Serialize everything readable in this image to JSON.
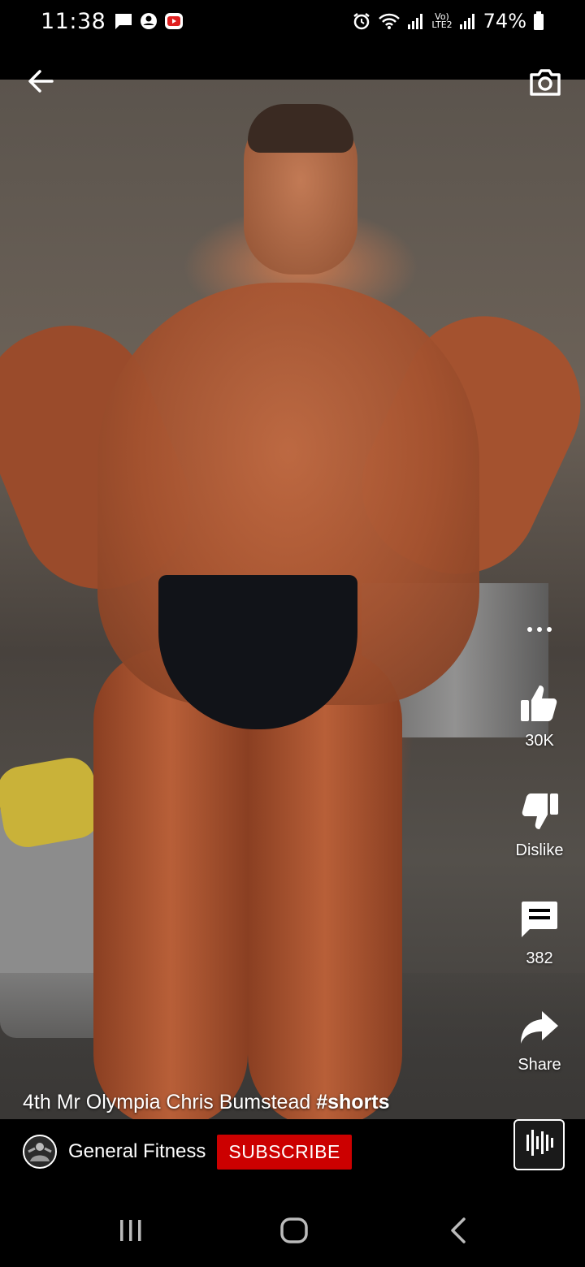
{
  "status_bar": {
    "time": "11:38",
    "battery": "74%",
    "left_icons": [
      "message-icon",
      "account-icon",
      "youtube-icon"
    ],
    "right_icons": [
      "alarm-icon",
      "wifi-icon",
      "signal-icon",
      "volte-icon",
      "signal-icon",
      "battery-icon"
    ],
    "volte_label": "Vo)\nLTE2"
  },
  "header": {
    "back_icon": "arrow-left-icon",
    "camera_icon": "camera-icon"
  },
  "actions": {
    "more_icon": "more-horizontal-icon",
    "like_count": "30K",
    "dislike_label": "Dislike",
    "comment_count": "382",
    "share_label": "Share"
  },
  "video": {
    "title_text": "4th Mr Olympia Chris Bumstead ",
    "title_hashtag": "#shorts"
  },
  "channel": {
    "name": "General Fitness",
    "subscribe_label": "SUBSCRIBE"
  },
  "nav": {
    "recents_icon": "recents-icon",
    "home_icon": "home-icon",
    "back_icon": "back-chevron-icon"
  },
  "colors": {
    "subscribe_red": "#cc0000",
    "background": "#000000"
  }
}
